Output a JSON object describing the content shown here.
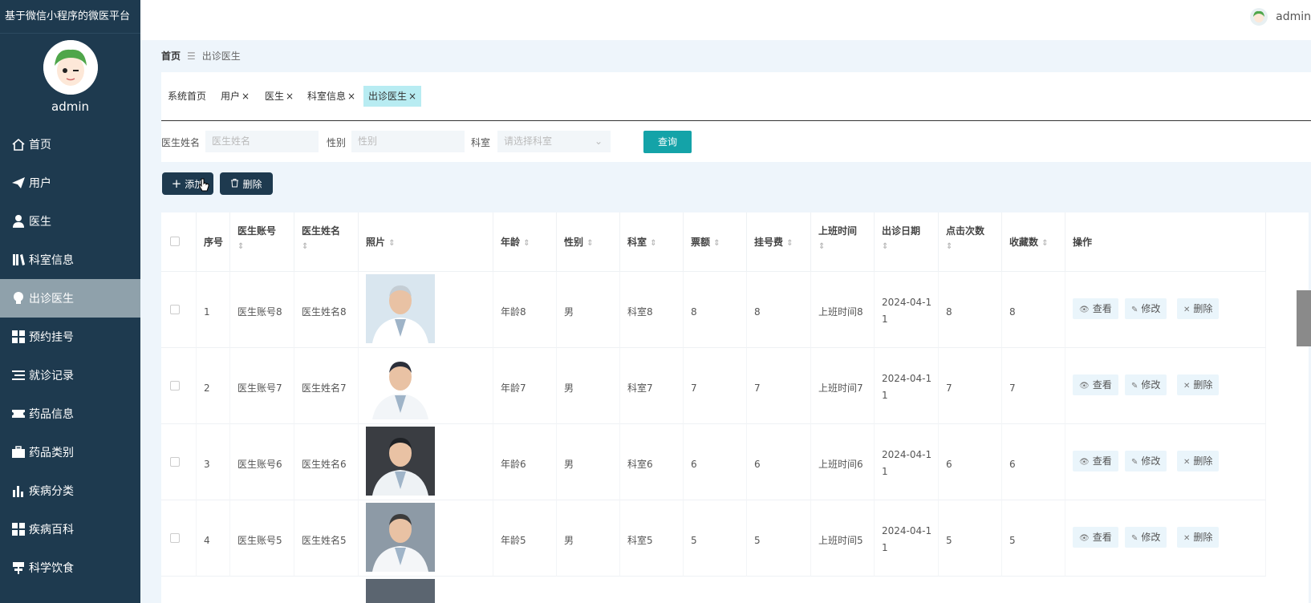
{
  "app": {
    "title": "基于微信小程序的微医平台",
    "user": "admin",
    "top_user": "admin"
  },
  "menu": [
    {
      "label": "首页",
      "icon": "home-icon"
    },
    {
      "label": "用户",
      "icon": "paper-plane-icon"
    },
    {
      "label": "医生",
      "icon": "person-icon"
    },
    {
      "label": "科室信息",
      "icon": "book-icon"
    },
    {
      "label": "出诊医生",
      "icon": "bulb-icon",
      "active": true
    },
    {
      "label": "预约挂号",
      "icon": "grid-icon"
    },
    {
      "label": "就诊记录",
      "icon": "list-icon"
    },
    {
      "label": "药品信息",
      "icon": "ticket-icon"
    },
    {
      "label": "药品类别",
      "icon": "briefcase-icon"
    },
    {
      "label": "疾病分类",
      "icon": "bar-chart-icon"
    },
    {
      "label": "疾病百科",
      "icon": "grid-icon"
    },
    {
      "label": "科学饮食",
      "icon": "signpost-icon"
    }
  ],
  "breadcrumb": {
    "home": "首页",
    "sep": "☰",
    "current": "出诊医生"
  },
  "tabs": [
    {
      "label": "系统首页",
      "closable": false
    },
    {
      "label": "用户",
      "closable": true
    },
    {
      "label": "医生",
      "closable": true
    },
    {
      "label": "科室信息",
      "closable": true
    },
    {
      "label": "出诊医生",
      "closable": true,
      "active": true
    }
  ],
  "tab_close": "×",
  "search": {
    "name_label": "医生姓名",
    "name_placeholder": "医生姓名",
    "gender_label": "性别",
    "gender_placeholder": "性别",
    "dept_label": "科室",
    "dept_placeholder": "请选择科室",
    "query_button": "查询"
  },
  "actions": {
    "add": "添加",
    "delete": "删除"
  },
  "table": {
    "headers": [
      "序号",
      "医生账号",
      "医生姓名",
      "照片",
      "年龄",
      "性别",
      "科室",
      "票额",
      "挂号费",
      "上班时间",
      "出诊日期",
      "点击次数",
      "收藏数",
      "操作"
    ],
    "sort_glyph": "⇕",
    "rows": [
      {
        "index": "1",
        "account": "医生账号8",
        "name": "医生姓名8",
        "age": "年龄8",
        "gender": "男",
        "dept": "科室8",
        "quota": "8",
        "fee": "8",
        "work_time": "上班时间8",
        "date_1": "2024-04-1",
        "date_2": "1",
        "clicks": "8",
        "favorites": "8"
      },
      {
        "index": "2",
        "account": "医生账号7",
        "name": "医生姓名7",
        "age": "年龄7",
        "gender": "男",
        "dept": "科室7",
        "quota": "7",
        "fee": "7",
        "work_time": "上班时间7",
        "date_1": "2024-04-1",
        "date_2": "1",
        "clicks": "7",
        "favorites": "7"
      },
      {
        "index": "3",
        "account": "医生账号6",
        "name": "医生姓名6",
        "age": "年龄6",
        "gender": "男",
        "dept": "科室6",
        "quota": "6",
        "fee": "6",
        "work_time": "上班时间6",
        "date_1": "2024-04-1",
        "date_2": "1",
        "clicks": "6",
        "favorites": "6"
      },
      {
        "index": "4",
        "account": "医生账号5",
        "name": "医生姓名5",
        "age": "年龄5",
        "gender": "男",
        "dept": "科室5",
        "quota": "5",
        "fee": "5",
        "work_time": "上班时间5",
        "date_1": "2024-04-1",
        "date_2": "1",
        "clicks": "5",
        "favorites": "5"
      }
    ],
    "row_actions": {
      "view": "查看",
      "edit": "修改",
      "delete": "删除"
    }
  },
  "colors": {
    "sidebar": "#1e3a4f",
    "accent": "#14a3a8",
    "active_menu": "#8fa1ab",
    "active_tab": "#b8ecf2"
  }
}
